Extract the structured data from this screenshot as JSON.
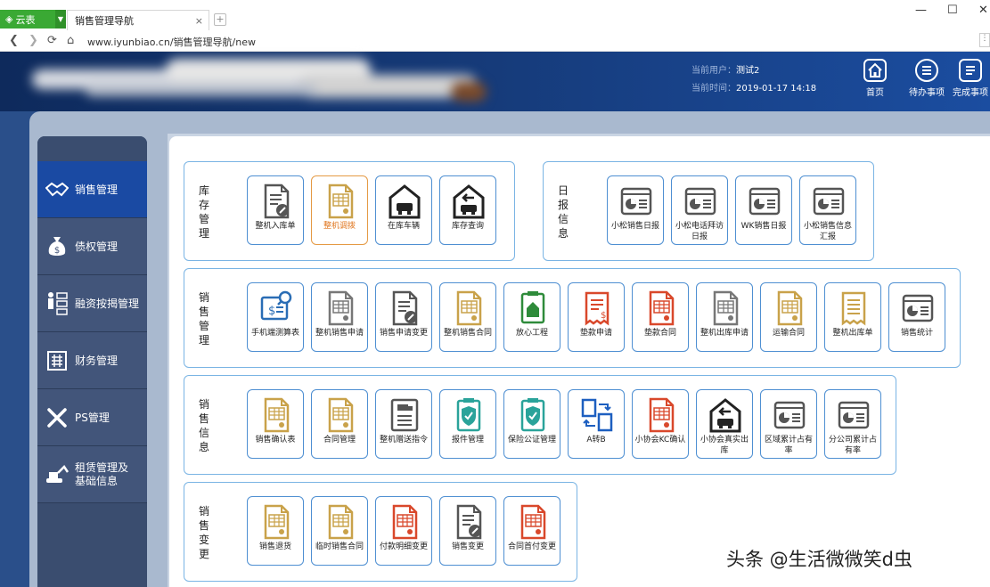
{
  "browser": {
    "brand_label": "云表",
    "tab_title": "销售管理导航",
    "close_glyph": "×",
    "new_tab_glyph": "+",
    "url": "www.iyunbiao.cn/销售管理导航/new",
    "window_minimize": "—",
    "window_maximize": "☐",
    "window_close": "✕"
  },
  "header": {
    "user_label": "当前用户：",
    "user_value": "测试2",
    "time_label": "当前时间：",
    "time_value": "2019-01-17 14:18",
    "buttons": [
      {
        "label": "首页",
        "icon": "home-icon"
      },
      {
        "label": "待办事项",
        "icon": "todo-icon"
      },
      {
        "label": "完成事项",
        "icon": "done-icon"
      }
    ]
  },
  "sidebar": {
    "items": [
      {
        "label": "销售管理",
        "icon": "handshake-icon"
      },
      {
        "label": "债权管理",
        "icon": "money-bag-icon"
      },
      {
        "label": "融资按揭管理",
        "icon": "checklist-icon"
      },
      {
        "label": "财务管理",
        "icon": "finance-icon"
      },
      {
        "label": "PS管理",
        "icon": "tools-icon"
      },
      {
        "label": "租赁管理及\n基础信息",
        "icon": "excavator-icon"
      }
    ]
  },
  "groups": {
    "inventory": {
      "title": "库存管理",
      "tiles": [
        {
          "label": "整机入库单",
          "icon": "doc-edit-icon",
          "color": "#555555"
        },
        {
          "label": "整机调拨",
          "icon": "doc-table-icon",
          "color": "#c9a24a"
        },
        {
          "label": "在库车辆",
          "icon": "garage-car-icon",
          "color": "#222222"
        },
        {
          "label": "库存查询",
          "icon": "garage-exit-icon",
          "color": "#222222"
        }
      ]
    },
    "daily": {
      "title": "日报信息",
      "tiles": [
        {
          "label": "小松销售日报",
          "icon": "report-chart-icon",
          "color": "#555555"
        },
        {
          "label": "小松电话拜访日报",
          "icon": "report-chart-icon",
          "color": "#555555"
        },
        {
          "label": "WK销售日报",
          "icon": "report-chart-icon",
          "color": "#555555"
        },
        {
          "label": "小松销售信息汇报",
          "icon": "report-chart-icon",
          "color": "#555555"
        }
      ]
    },
    "sales_mgmt": {
      "title": "销售管理",
      "tiles": [
        {
          "label": "手机端测算表",
          "icon": "calc-search-icon",
          "color": "#2a6db5"
        },
        {
          "label": "整机销售申请",
          "icon": "doc-table-icon",
          "color": "#777777"
        },
        {
          "label": "销售申请变更",
          "icon": "doc-edit-icon",
          "color": "#555555"
        },
        {
          "label": "整机销售合同",
          "icon": "doc-table-icon",
          "color": "#c9a24a"
        },
        {
          "label": "放心工程",
          "icon": "doc-house-icon",
          "color": "#2e8b3a"
        },
        {
          "label": "垫款申请",
          "icon": "receipt-dollar-icon",
          "color": "#d9482b"
        },
        {
          "label": "垫款合同",
          "icon": "doc-table-icon",
          "color": "#d9482b"
        },
        {
          "label": "整机出库申请",
          "icon": "doc-table-icon",
          "color": "#777777"
        },
        {
          "label": "运输合同",
          "icon": "doc-table-icon",
          "color": "#c9a24a"
        },
        {
          "label": "整机出库单",
          "icon": "receipt-lines-icon",
          "color": "#c9a24a"
        },
        {
          "label": "销售统计",
          "icon": "report-chart-icon",
          "color": "#555555"
        }
      ]
    },
    "sales_info": {
      "title": "销售信息",
      "tiles": [
        {
          "label": "销售确认表",
          "icon": "doc-table-icon",
          "color": "#c9a24a"
        },
        {
          "label": "合同管理",
          "icon": "doc-table-icon",
          "color": "#c9a24a"
        },
        {
          "label": "整机赠送指令",
          "icon": "truck-list-icon",
          "color": "#555555"
        },
        {
          "label": "报件管理",
          "icon": "shield-clipboard-icon",
          "color": "#2aa39a"
        },
        {
          "label": "保险公证管理",
          "icon": "shield-clipboard-icon",
          "color": "#2aa39a"
        },
        {
          "label": "A转B",
          "icon": "swap-docs-icon",
          "color": "#1d5fc0"
        },
        {
          "label": "小协会KC确认",
          "icon": "doc-table-icon",
          "color": "#d9482b"
        },
        {
          "label": "小协会真实出库",
          "icon": "garage-exit-icon",
          "color": "#222222"
        },
        {
          "label": "区域累计占有率",
          "icon": "report-chart-icon",
          "color": "#555555"
        },
        {
          "label": "分公司累计占有率",
          "icon": "report-chart-icon",
          "color": "#555555"
        }
      ]
    },
    "sales_change": {
      "title": "销售变更",
      "tiles": [
        {
          "label": "销售退货",
          "icon": "doc-table-icon",
          "color": "#c9a24a"
        },
        {
          "label": "临时销售合同",
          "icon": "doc-table-icon",
          "color": "#c9a24a"
        },
        {
          "label": "付款明细变更",
          "icon": "doc-table-icon",
          "color": "#d9482b"
        },
        {
          "label": "销售变更",
          "icon": "doc-edit-icon",
          "color": "#555555"
        },
        {
          "label": "合同首付变更",
          "icon": "doc-table-icon",
          "color": "#d9482b"
        }
      ]
    }
  },
  "watermark": "头条 @生活微微笑d虫"
}
